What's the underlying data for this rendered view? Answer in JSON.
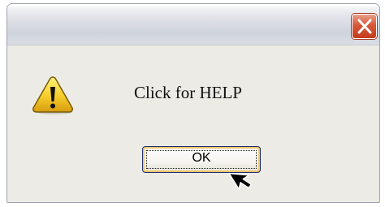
{
  "dialog": {
    "title": "",
    "message": "Click for HELP",
    "ok_label": "OK"
  },
  "icons": {
    "warning": "warning-icon",
    "close": "close-icon",
    "cursor": "mouse-cursor-icon"
  },
  "colors": {
    "close_button": "#d6583a",
    "warning_yellow": "#f6cd2b",
    "focus_ring": "#f0c46a",
    "dialog_background": "#ecebe5"
  }
}
